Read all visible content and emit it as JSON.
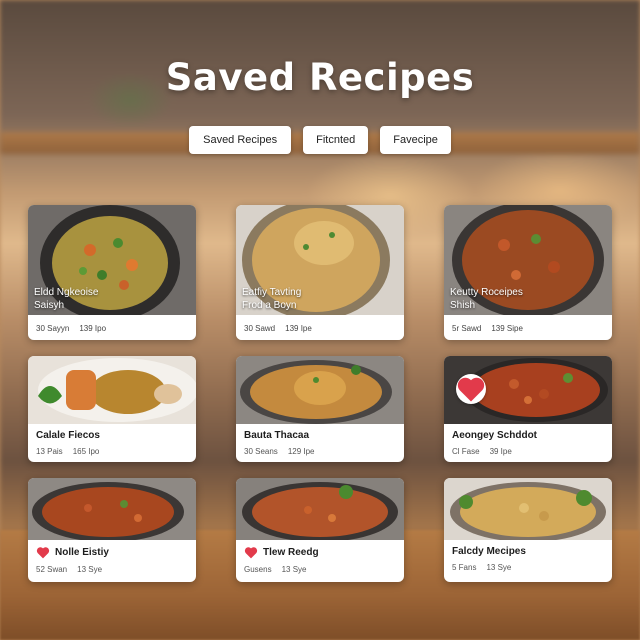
{
  "page": {
    "title": "Saved Recipes"
  },
  "tabs": [
    {
      "label": "Saved Recipes"
    },
    {
      "label": "Fitcnted"
    },
    {
      "label": "Favecipe"
    }
  ],
  "colors": {
    "card_bg": "#ffffff",
    "heart": "#e23a4b",
    "title": "#ffffff"
  },
  "cards": [
    {
      "title_line1": "Eldd Ngkeoise",
      "title_line2": "Saisyh",
      "meta_left": "30 Sayyn",
      "meta_right": "139 Ipo",
      "favorite": false
    },
    {
      "title_line1": "Eatfiy Tavting",
      "title_line2": "Frod a Boyn",
      "meta_left": "30 Sawd",
      "meta_right": "139 Ipe",
      "favorite": false
    },
    {
      "title_line1": "Keutty Roceipes",
      "title_line2": "Shish",
      "meta_left": "5r Sawd",
      "meta_right": "139 Sipe",
      "favorite": false
    },
    {
      "title": "Calale Fiecos",
      "meta_left": "13 Pais",
      "meta_right": "165 Ipo",
      "favorite": false
    },
    {
      "title": "Bauta Thacaa",
      "meta_left": "30 Seans",
      "meta_right": "129 Ipe",
      "favorite": false
    },
    {
      "title": "Aeongey Schddot",
      "meta_left": "Cl Fase",
      "meta_right": "39 Ipe",
      "favorite": true
    },
    {
      "title": "Nolle Eistiy",
      "meta_left": "52 Swan",
      "meta_right": "13 Sye",
      "favorite": true
    },
    {
      "title": "Tlew Reedg",
      "meta_left": "Gusens",
      "meta_right": "13 Sye",
      "favorite": true
    },
    {
      "title": "Falcdy Mecipes",
      "meta_left": "5 Fans",
      "meta_right": "13 Sye",
      "favorite": false
    }
  ]
}
